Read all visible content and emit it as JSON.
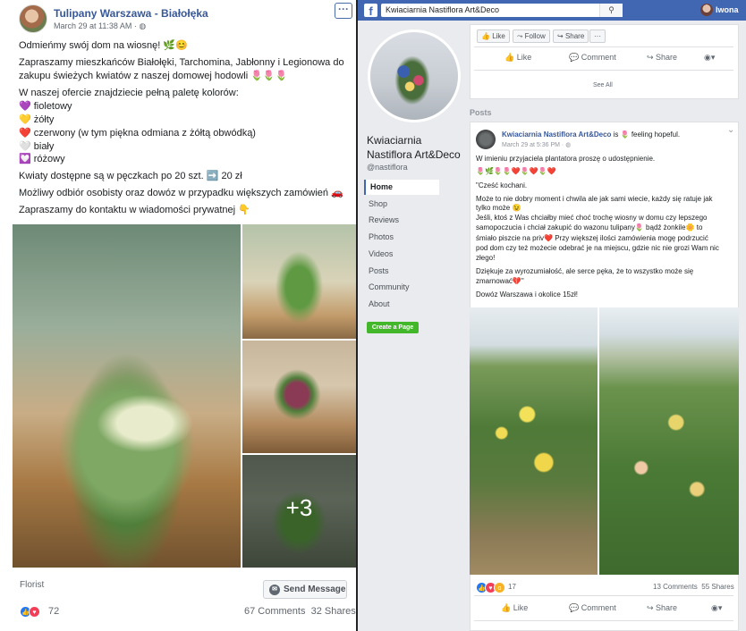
{
  "left_post": {
    "page_name": "Tulipany Warszawa - Białołęka",
    "date": "March 29 at 11:38 AM · ",
    "more": "···",
    "lines": [
      "Odmieńmy swój dom na wiosnę! 🌿😊",
      "Zapraszamy mieszkańców Białołęki, Tarchomina, Jabłonny i Legionowa do",
      "zakupu świeżych kwiatów z naszej domowej hodowli 🌷🌷🌷",
      "W naszej ofercie znajdziecie pełną paletę kolorów:",
      "💜 fioletowy",
      "💛 żółty",
      "❤️ czerwony (w tym piękna odmiana z żółtą obwódką)",
      "🤍 biały",
      "💟 różowy",
      "Kwiaty dostępne są w pęczkach po 20 szt. ➡️ 20 zł",
      "Możliwy odbiór osobisty oraz dowóz w przypadku większych zamówień 🚗",
      "Zapraszamy do kontaktu w wiadomości prywatnej 👇"
    ],
    "more_photos": "+3",
    "category": "Florist",
    "send_message": "Send Message",
    "reaction_count": "72",
    "comments": "67 Comments",
    "shares": "32 Shares"
  },
  "right_page": {
    "search_text": "Kwiaciarnia Nastiflora Art&Deco",
    "user_name": "Iwona",
    "page_title_line1": "Kwiaciarnia",
    "page_title_line2": "Nastiflora Art&Deco",
    "handle": "@nastiflora",
    "nav": [
      "Home",
      "Shop",
      "Reviews",
      "Photos",
      "Videos",
      "Posts",
      "Community",
      "About"
    ],
    "create_page": "Create a Page",
    "top_buttons": {
      "like": "Like",
      "follow": "Follow",
      "share": "Share",
      "more": "···"
    },
    "top_actions": {
      "like": "Like",
      "comment": "Comment",
      "share": "Share"
    },
    "see_all": "See All",
    "posts_label": "Posts",
    "post": {
      "author": "Kwiaciarnia Nastiflora Art&Deco",
      "feeling": " is 🌷 feeling hopeful.",
      "date": "March 29 at 5:36 PM · ",
      "lines": [
        "W imieniu przyjaciela plantatora proszę o udostępnienie.",
        "🌷🌿🌷🌷❤️🌷❤️🌷❤️",
        "\"Cześć kochani.",
        "Może to nie dobry moment i chwila ale jak sami wiecie, każdy się ratuje jak",
        "tylko może 😉",
        "Jeśli, ktoś z Was chciałby mieć choć trochę wiosny w domu czy lepszego",
        "samopoczucia i chciał zakupić do wazonu tulipany🌷 bądź żonkile🌼 to",
        "śmiało piszcie na priv❤️  Przy większej ilości zamówienia mogę podrzucić",
        "pod dom czy też możecie odebrać je na miejscu, gdzie nic nie grozi Wam nic",
        "złego!",
        "Dziękuje za wyrozumiałość, ale serce pęka, że to wszystko może się",
        "zmarnować💔\"",
        "Dowóz Warszawa i okolice 15zł!"
      ],
      "reaction_count": "17",
      "comments": "13 Comments",
      "shares": "55 Shares",
      "actions": {
        "like": "Like",
        "comment": "Comment",
        "share": "Share"
      }
    }
  }
}
